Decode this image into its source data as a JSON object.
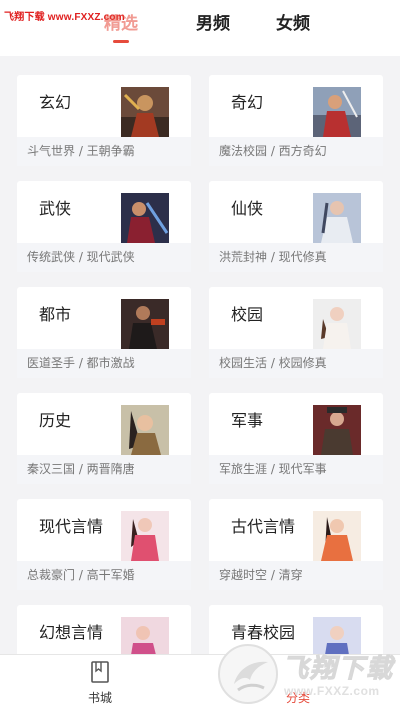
{
  "watermark": {
    "top_text": "飞翔下载 www.FXXZ.com",
    "logo_text": "飞翔下载",
    "logo_url": "www.FXXZ.com"
  },
  "tabs": [
    {
      "label": "精选",
      "active": true
    },
    {
      "label": "男频",
      "active": false
    },
    {
      "label": "女频",
      "active": false
    }
  ],
  "accent_color": "#e64b3c",
  "categories": [
    {
      "title": "玄幻",
      "subtitle": "斗气世界 / 王朝争霸"
    },
    {
      "title": "奇幻",
      "subtitle": "魔法校园 / 西方奇幻"
    },
    {
      "title": "武侠",
      "subtitle": "传统武侠 / 现代武侠"
    },
    {
      "title": "仙侠",
      "subtitle": "洪荒封神 / 现代修真"
    },
    {
      "title": "都市",
      "subtitle": "医道圣手 / 都市激战"
    },
    {
      "title": "校园",
      "subtitle": "校园生活 / 校园修真"
    },
    {
      "title": "历史",
      "subtitle": "秦汉三国 / 两晋隋唐"
    },
    {
      "title": "军事",
      "subtitle": "军旅生涯 / 现代军事"
    },
    {
      "title": "现代言情",
      "subtitle": "总裁豪门 / 高干军婚"
    },
    {
      "title": "古代言情",
      "subtitle": "穿越时空 / 清穿"
    },
    {
      "title": "幻想言情",
      "subtitle": ""
    },
    {
      "title": "青春校园",
      "subtitle": ""
    }
  ],
  "bottom_nav": [
    {
      "label": "书城",
      "icon": "book-icon"
    },
    {
      "label": "分类",
      "icon": "category-icon",
      "active": true
    }
  ]
}
